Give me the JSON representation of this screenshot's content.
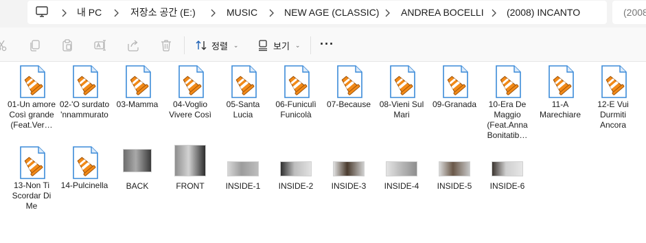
{
  "address_bar": {
    "crumbs": [
      "내 PC",
      "저장소 공간 (E:)",
      "MUSIC",
      "NEW AGE (CLASSIC)",
      "ANDREA BOCELLI",
      "(2008) INCANTO"
    ],
    "search_text": "(2008"
  },
  "command_bar": {
    "sort_label": "정렬",
    "view_label": "보기",
    "more_label": "···"
  },
  "files": [
    {
      "name": "01-Un amore Così grande (Feat.Ver…",
      "type": "audio"
    },
    {
      "name": "02-'O surdato 'nnammurato",
      "type": "audio"
    },
    {
      "name": "03-Mamma",
      "type": "audio"
    },
    {
      "name": "04-Voglio Vivere Così",
      "type": "audio"
    },
    {
      "name": "05-Santa Lucia",
      "type": "audio"
    },
    {
      "name": "06-Funiculì Funicolà",
      "type": "audio"
    },
    {
      "name": "07-Because",
      "type": "audio"
    },
    {
      "name": "08-Vieni Sul Mari",
      "type": "audio"
    },
    {
      "name": "09-Granada",
      "type": "audio"
    },
    {
      "name": "10-Era De Maggio (Feat.Anna Bonitatib…",
      "type": "audio"
    },
    {
      "name": "11-A Marechiare",
      "type": "audio"
    },
    {
      "name": "12-E Vui Durmiti Ancora",
      "type": "audio"
    },
    {
      "name": "13-Non Ti Scordar Di Me",
      "type": "audio"
    },
    {
      "name": "14-Pulcinella",
      "type": "audio"
    },
    {
      "name": "BACK",
      "type": "image"
    },
    {
      "name": "FRONT",
      "type": "image"
    },
    {
      "name": "INSIDE-1",
      "type": "image"
    },
    {
      "name": "INSIDE-2",
      "type": "image"
    },
    {
      "name": "INSIDE-3",
      "type": "image"
    },
    {
      "name": "INSIDE-4",
      "type": "image"
    },
    {
      "name": "INSIDE-5",
      "type": "image"
    },
    {
      "name": "INSIDE-6",
      "type": "image"
    }
  ],
  "icons": {
    "pc": "monitor-icon",
    "separator": "chevron-right-icon",
    "cut": "scissors-icon",
    "copy": "copy-icon",
    "paste": "paste-icon",
    "rename": "rename-icon",
    "share": "share-icon",
    "delete": "trash-icon",
    "sort": "sort-arrows-icon",
    "view": "view-icon",
    "audio_file": "vlc-audio-file-icon"
  }
}
